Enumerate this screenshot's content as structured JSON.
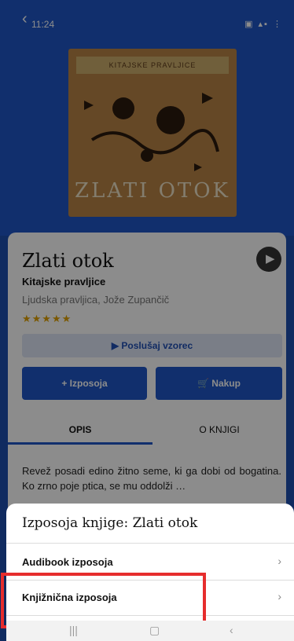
{
  "status_bar": {
    "time": "11:24",
    "icons": "▣ ▴▪ ⋮"
  },
  "cover": {
    "top_text": "KITAJSKE PRAVLJICE",
    "title": "ZLATI OTOK"
  },
  "book": {
    "title": "Zlati otok",
    "subtitle": "Kitajske pravljice",
    "authors": "Ljudska pravljica, Jože Zupančič",
    "stars": "★★★★★",
    "rating": 5
  },
  "actions": {
    "listen_label": "Poslušaj vzorec",
    "borrow_label": "Izposoja",
    "buy_label": "Nakup"
  },
  "tabs": [
    {
      "label": "OPIS",
      "active": true
    },
    {
      "label": "O KNJIGI",
      "active": false
    }
  ],
  "description": "Revež posadi edino žitno seme, ki ga dobi od bogatina. Ko zrno poje ptica, se mu oddolži …",
  "sheet": {
    "title": "Izposoja knjige: Zlati otok",
    "options": [
      {
        "label": "Audibook izposoja"
      },
      {
        "label": "Knjižnična izposoja"
      }
    ]
  },
  "colors": {
    "accent": "#1f57c6",
    "highlight": "#e62d2d",
    "stars": "#e0a100"
  }
}
